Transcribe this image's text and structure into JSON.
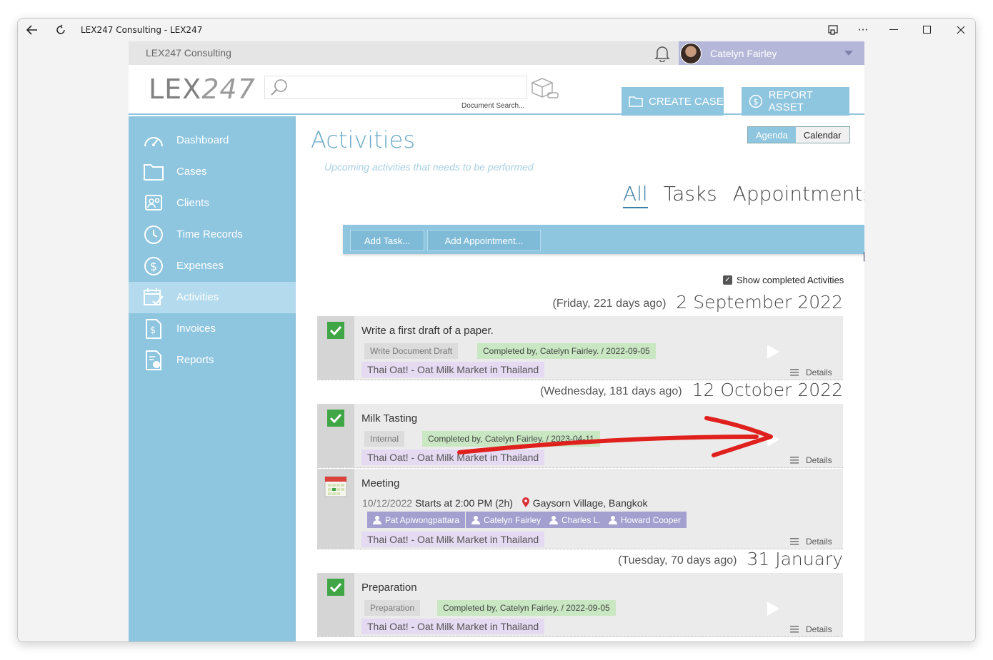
{
  "window": {
    "title": "LEX247 Consulting - LEX247",
    "back_icon": "back-arrow-icon",
    "refresh_icon": "refresh-icon"
  },
  "topbar": {
    "company": "LEX247 Consulting",
    "user_name": "Catelyn Fairley"
  },
  "header": {
    "logo_a": "LEX",
    "logo_b": "247",
    "search_placeholder": "",
    "search_caption": "Document Search...",
    "create_case": "CREATE CASE",
    "report_asset": "REPORT ASSET"
  },
  "sidebar": {
    "items": [
      {
        "label": "Dashboard",
        "icon": "gauge-icon"
      },
      {
        "label": "Cases",
        "icon": "folder-icon"
      },
      {
        "label": "Clients",
        "icon": "clients-icon"
      },
      {
        "label": "Time Records",
        "icon": "clock-icon"
      },
      {
        "label": "Expenses",
        "icon": "dollar-icon"
      },
      {
        "label": "Activities",
        "icon": "calendar-check-icon",
        "active": true
      },
      {
        "label": "Invoices",
        "icon": "invoice-icon"
      },
      {
        "label": "Reports",
        "icon": "report-icon"
      }
    ]
  },
  "main": {
    "title": "Activities",
    "subtitle": "Upcoming activities that needs to be performed",
    "view_agenda": "Agenda",
    "view_calendar": "Calendar",
    "tabs": [
      "All",
      "Tasks",
      "Appointments"
    ],
    "add_task": "Add Task...",
    "add_appointment": "Add Appointment...",
    "show_completed": "Show completed Activities",
    "details_label": "Details"
  },
  "groups": [
    {
      "relative": "(Friday, 221 days ago)",
      "date": "2 September 2022",
      "items": [
        {
          "title": "Write a first draft of a paper.",
          "type_tag": "Write Document Draft",
          "completed": "Completed by, Catelyn Fairley. / 2022-09-05",
          "matter": "Thai Oat! - Oat Milk Market in Thailand"
        }
      ]
    },
    {
      "relative": "(Wednesday, 181 days ago)",
      "date": "12 October 2022",
      "items": [
        {
          "title": "Milk Tasting",
          "type_tag": "Internal",
          "completed": "Completed by, Catelyn Fairley. / 2023-04-11",
          "matter": "Thai Oat! - Oat Milk Market in Thailand"
        },
        {
          "title": "Meeting",
          "date": "10/12/2022",
          "time": "Starts at 2:00 PM (2h)",
          "location": "Gaysorn Village, Bangkok",
          "attendees": [
            "Pat Apiwongpattara",
            "Catelyn Fairley",
            "Charles L.",
            "Howard Cooper"
          ],
          "matter": "Thai Oat! - Oat Milk Market in Thailand"
        }
      ]
    },
    {
      "relative": "(Tuesday, 70 days ago)",
      "date": "31 January",
      "items": [
        {
          "title": "Preparation",
          "type_tag": "Preparation",
          "completed": "Completed by, Catelyn Fairley. / 2022-09-05",
          "matter": "Thai Oat! - Oat Milk Market in Thailand"
        }
      ]
    }
  ],
  "colors": {
    "accent": "#8ec5df",
    "completed_tag": "#c9e7c2",
    "matter_tag": "#e4daf1",
    "attendee_tag": "#a39fcf",
    "annotation_arrow": "#e0201c"
  }
}
